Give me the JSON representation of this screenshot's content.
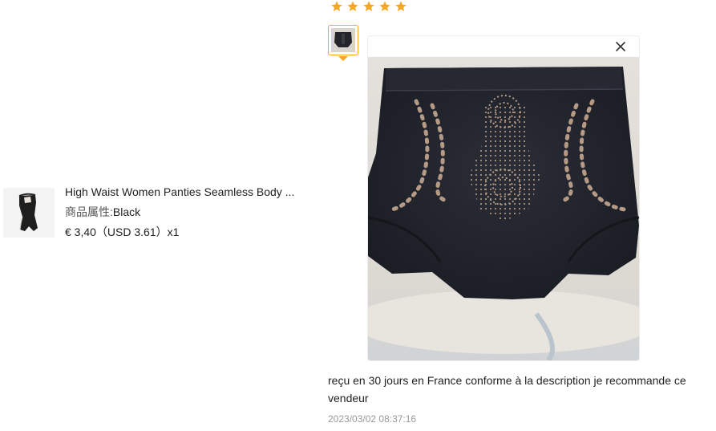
{
  "product": {
    "title": "High Waist Women Panties Seamless Body ...",
    "attr_key": "商品属性:",
    "attr_value": "Black",
    "price": "€ 3,40（USD  3.61）x1"
  },
  "review": {
    "rating": 5,
    "star_color": "#f5a623",
    "text": "reçu en 30 jours en France conforme à la description je recommande ce vendeur",
    "date": "2023/03/02 08:37:16"
  },
  "photo_viewer": {
    "close_icon": "close-icon"
  }
}
